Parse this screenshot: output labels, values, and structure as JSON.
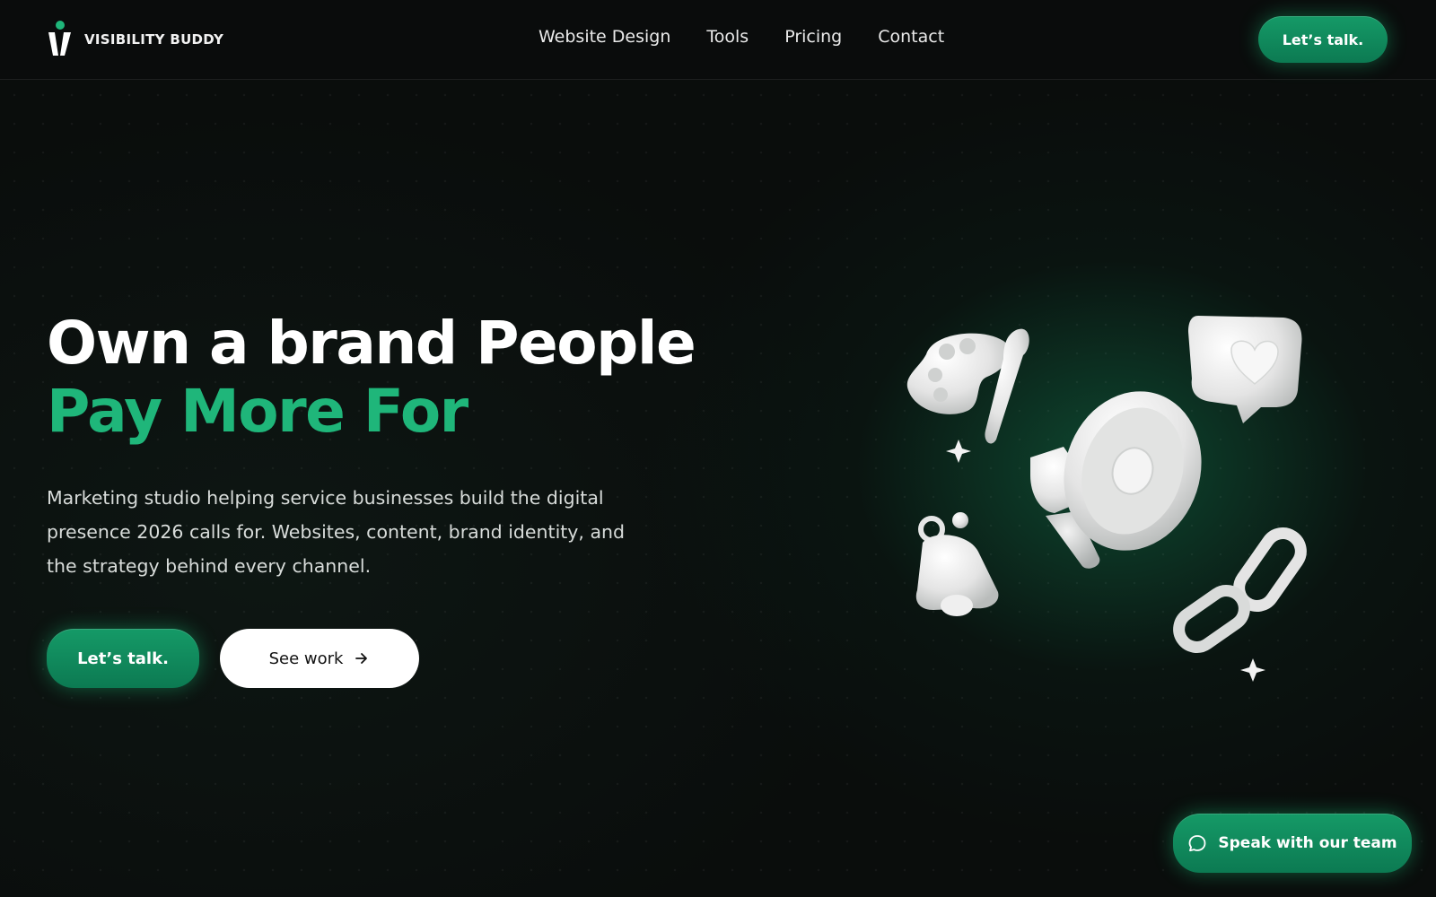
{
  "brand": {
    "name": "VISIBILITY BUDDY",
    "accent": "#1fb67a"
  },
  "header": {
    "nav": [
      {
        "label": "Website Design"
      },
      {
        "label": "Tools"
      },
      {
        "label": "Pricing"
      },
      {
        "label": "Contact"
      }
    ],
    "cta_label": "Let’s talk."
  },
  "hero": {
    "headline_line1": "Own a brand People",
    "headline_line2": "Pay More For",
    "subtext": "Marketing studio helping service businesses build the digital presence 2026 calls for. Websites, content, brand identity, and the strategy behind every channel.",
    "primary_cta": "Let’s talk.",
    "secondary_cta": "See work",
    "secondary_icon": "arrow-right-icon",
    "illustration_icons": [
      "palette-icon",
      "megaphone-icon",
      "heart-message-icon",
      "bell-icon",
      "link-icon",
      "sparkle-icon"
    ]
  },
  "chat_widget": {
    "label": "Speak with our team",
    "icon": "chat-bubble-icon"
  }
}
